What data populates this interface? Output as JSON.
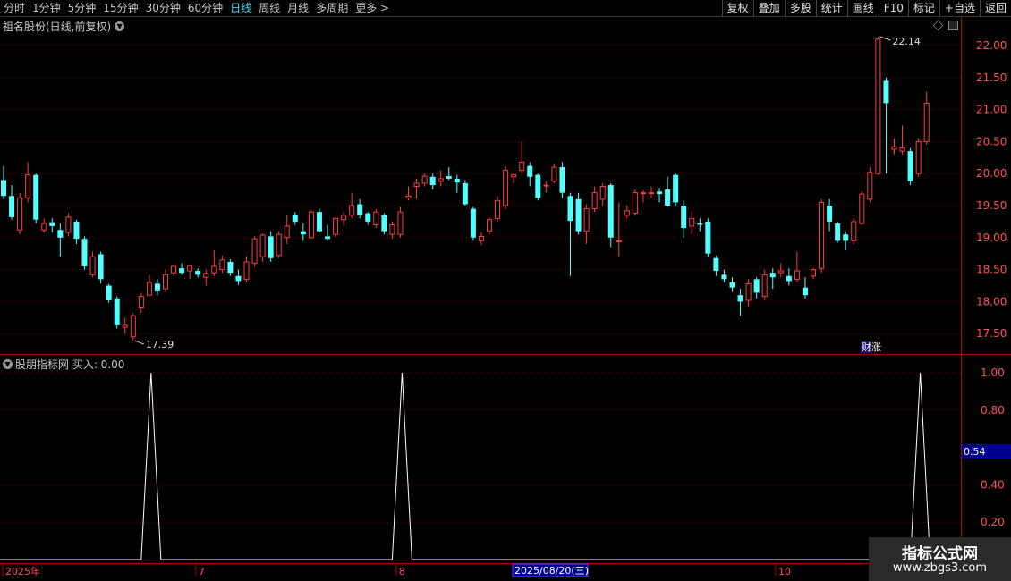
{
  "toolbar": {
    "periods": [
      "分时",
      "1分钟",
      "5分钟",
      "15分钟",
      "30分钟",
      "60分钟",
      "日线",
      "周线",
      "月线",
      "多周期",
      "更多 >"
    ],
    "active_period": "日线",
    "buttons": [
      "复权",
      "叠加",
      "多股",
      "统计",
      "画线",
      "F10",
      "标记",
      "+自选",
      "返回"
    ]
  },
  "main_chart": {
    "title": "祖名股份(日线,前复权)",
    "price_axis": [
      "22.00",
      "21.50",
      "21.00",
      "20.50",
      "20.00",
      "19.50",
      "19.00",
      "18.50",
      "18.00",
      "17.50"
    ],
    "high_label": "22.14",
    "low_label": "17.39",
    "marker_label": "财涨"
  },
  "indicator": {
    "title": "股朋指标网 买入: 0.00",
    "axis": [
      "1.00",
      "0.80",
      "0.40",
      "0.20"
    ],
    "cursor_value": "0.54"
  },
  "date_axis": {
    "labels": [
      "2025年",
      "7",
      "8",
      "2025/08/20(三)",
      "10"
    ]
  },
  "watermark": {
    "line1": "指标公式网",
    "line2": "www.zbgs3.com"
  },
  "colors": {
    "up": "#ff3d3d",
    "down": "#54ffff",
    "grid": "#7a0000",
    "border": "#b00000",
    "axis_text": "#ff5050",
    "indicator_line": "#ffffff",
    "highlight_box": "#000090"
  },
  "chart_data": {
    "type": "candlestick",
    "ylim": [
      17.3,
      22.2
    ],
    "candles": [
      [
        19.9,
        19.65,
        20.12,
        19.6
      ],
      [
        19.65,
        19.32,
        19.82,
        19.28
      ],
      [
        19.12,
        19.62,
        19.7,
        19.05
      ],
      [
        19.62,
        19.98,
        20.18,
        19.55
      ],
      [
        19.98,
        19.28,
        20.0,
        19.22
      ],
      [
        19.12,
        19.22,
        19.3,
        19.08
      ],
      [
        19.24,
        19.18,
        19.3,
        19.08
      ],
      [
        19.12,
        19.0,
        19.22,
        18.7
      ],
      [
        19.08,
        19.32,
        19.38,
        19.02
      ],
      [
        19.25,
        18.98,
        19.28,
        18.9
      ],
      [
        18.98,
        18.55,
        19.02,
        18.5
      ],
      [
        18.42,
        18.7,
        18.78,
        18.38
      ],
      [
        18.74,
        18.35,
        18.78,
        18.28
      ],
      [
        18.25,
        18.02,
        18.28,
        17.98
      ],
      [
        18.05,
        17.63,
        18.08,
        17.58
      ],
      [
        17.6,
        17.63,
        17.75,
        17.5
      ],
      [
        17.45,
        17.78,
        17.82,
        17.39
      ],
      [
        17.9,
        18.08,
        18.14,
        17.82
      ],
      [
        18.1,
        18.3,
        18.42,
        18.15
      ],
      [
        18.28,
        18.16,
        18.35,
        18.1
      ],
      [
        18.2,
        18.42,
        18.5,
        18.15
      ],
      [
        18.45,
        18.55,
        18.58,
        18.4
      ],
      [
        18.52,
        18.45,
        18.6,
        18.42
      ],
      [
        18.48,
        18.56,
        18.58,
        18.35
      ],
      [
        18.48,
        18.42,
        18.52,
        18.38
      ],
      [
        18.38,
        18.44,
        18.5,
        18.25
      ],
      [
        18.45,
        18.55,
        18.8,
        18.4
      ],
      [
        18.5,
        18.65,
        18.72,
        18.45
      ],
      [
        18.62,
        18.45,
        18.66,
        18.4
      ],
      [
        18.4,
        18.32,
        18.5,
        18.26
      ],
      [
        18.35,
        18.62,
        18.7,
        18.3
      ],
      [
        18.6,
        18.98,
        19.02,
        18.55
      ],
      [
        18.7,
        19.04,
        19.06,
        18.62
      ],
      [
        19.02,
        18.68,
        19.1,
        18.62
      ],
      [
        18.72,
        19.05,
        19.1,
        18.68
      ],
      [
        19.0,
        19.18,
        19.36,
        18.9
      ],
      [
        19.36,
        19.25,
        19.4,
        19.2
      ],
      [
        19.1,
        19.05,
        19.22,
        18.95
      ],
      [
        19.0,
        19.4,
        19.42,
        18.98
      ],
      [
        19.4,
        19.1,
        19.45,
        19.08
      ],
      [
        19.02,
        18.98,
        19.2,
        18.95
      ],
      [
        19.05,
        19.3,
        19.32,
        19.0
      ],
      [
        19.28,
        19.35,
        19.4,
        19.18
      ],
      [
        19.35,
        19.5,
        19.7,
        19.3
      ],
      [
        19.52,
        19.35,
        19.6,
        19.3
      ],
      [
        19.38,
        19.25,
        19.4,
        19.2
      ],
      [
        19.2,
        19.4,
        19.45,
        19.15
      ],
      [
        19.35,
        19.1,
        19.38,
        19.05
      ],
      [
        19.05,
        19.2,
        19.25,
        18.98
      ],
      [
        19.05,
        19.4,
        19.48,
        19.0
      ],
      [
        19.62,
        19.65,
        19.8,
        19.58
      ],
      [
        19.8,
        19.85,
        19.92,
        19.6
      ],
      [
        19.85,
        19.96,
        20.0,
        19.8
      ],
      [
        19.95,
        19.82,
        20.0,
        19.75
      ],
      [
        19.88,
        19.92,
        20.05,
        19.8
      ],
      [
        19.96,
        19.92,
        20.1,
        19.9
      ],
      [
        19.92,
        19.86,
        19.98,
        19.7
      ],
      [
        19.85,
        19.52,
        19.9,
        19.5
      ],
      [
        19.45,
        19.0,
        19.48,
        18.95
      ],
      [
        18.95,
        19.02,
        19.08,
        18.88
      ],
      [
        19.1,
        19.28,
        19.32,
        19.05
      ],
      [
        19.3,
        19.58,
        19.65,
        19.25
      ],
      [
        19.5,
        20.05,
        20.12,
        19.45
      ],
      [
        19.95,
        19.98,
        20.02,
        19.85
      ],
      [
        20.05,
        20.18,
        20.5,
        20.0
      ],
      [
        20.12,
        19.95,
        20.18,
        19.8
      ],
      [
        19.98,
        19.62,
        20.0,
        19.58
      ],
      [
        19.82,
        19.82,
        19.88,
        19.7
      ],
      [
        19.88,
        20.1,
        20.15,
        19.85
      ],
      [
        20.1,
        19.7,
        20.18,
        19.62
      ],
      [
        19.65,
        19.26,
        19.7,
        18.4
      ],
      [
        19.6,
        19.1,
        19.7,
        19.05
      ],
      [
        19.1,
        19.45,
        19.52,
        18.9
      ],
      [
        19.45,
        19.7,
        19.8,
        19.4
      ],
      [
        19.6,
        19.8,
        19.85,
        19.5
      ],
      [
        19.82,
        19.0,
        19.85,
        18.85
      ],
      [
        18.95,
        18.95,
        19.55,
        18.7
      ],
      [
        19.35,
        19.42,
        19.5,
        19.3
      ],
      [
        19.38,
        19.7,
        19.75,
        19.35
      ],
      [
        19.7,
        19.7,
        19.74,
        19.55
      ],
      [
        19.7,
        19.7,
        19.8,
        19.62
      ],
      [
        19.72,
        19.68,
        19.78,
        19.55
      ],
      [
        19.75,
        19.5,
        19.95,
        19.48
      ],
      [
        19.98,
        19.55,
        20.0,
        19.5
      ],
      [
        19.5,
        19.15,
        19.58,
        19.0
      ],
      [
        19.18,
        19.3,
        19.42,
        19.05
      ],
      [
        19.22,
        19.2,
        19.3,
        19.1
      ],
      [
        19.25,
        18.75,
        19.3,
        18.7
      ],
      [
        18.68,
        18.48,
        18.72,
        18.4
      ],
      [
        18.42,
        18.35,
        18.5,
        18.3
      ],
      [
        18.3,
        18.22,
        18.38,
        18.15
      ],
      [
        18.1,
        18.0,
        18.2,
        17.78
      ],
      [
        18.02,
        18.28,
        18.35,
        17.92
      ],
      [
        18.35,
        18.14,
        18.38,
        18.05
      ],
      [
        18.08,
        18.42,
        18.5,
        18.02
      ],
      [
        18.45,
        18.38,
        18.52,
        18.2
      ],
      [
        18.45,
        18.48,
        18.6,
        18.38
      ],
      [
        18.4,
        18.32,
        18.52,
        18.25
      ],
      [
        18.35,
        18.48,
        18.78,
        18.3
      ],
      [
        18.22,
        18.1,
        18.38,
        18.05
      ],
      [
        18.4,
        18.5,
        18.52,
        18.35
      ],
      [
        18.52,
        19.55,
        19.6,
        18.45
      ],
      [
        19.5,
        19.25,
        19.6,
        19.1
      ],
      [
        19.22,
        18.95,
        19.25,
        18.92
      ],
      [
        19.05,
        18.95,
        19.1,
        18.8
      ],
      [
        18.95,
        19.25,
        19.3,
        18.9
      ],
      [
        19.22,
        19.68,
        19.72,
        19.2
      ],
      [
        19.6,
        20.02,
        20.1,
        19.55
      ],
      [
        20.0,
        22.1,
        22.14,
        19.98
      ],
      [
        21.45,
        21.1,
        21.5,
        20.0
      ],
      [
        20.38,
        20.42,
        20.55,
        20.3
      ],
      [
        20.35,
        20.4,
        20.75,
        20.3
      ],
      [
        20.35,
        19.88,
        20.4,
        19.82
      ],
      [
        20.0,
        20.5,
        20.55,
        19.95
      ],
      [
        20.5,
        21.1,
        21.28,
        20.45
      ]
    ],
    "signal": {
      "ylim": [
        0,
        1.05
      ],
      "peaks_at_candle": [
        17,
        48,
        112
      ],
      "peak_value": 1.0,
      "base_value": 0.0
    }
  }
}
